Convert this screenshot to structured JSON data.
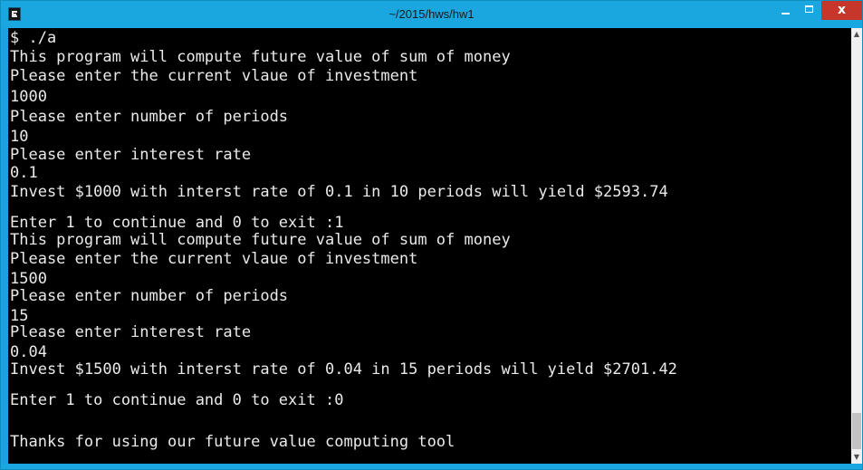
{
  "window": {
    "title": "~/2015/hws/hw1",
    "icon": "terminal-app-icon",
    "controls": {
      "minimize_icon": "minimize-icon",
      "maximize_icon": "maximize-icon",
      "close_label": "x"
    },
    "colors": {
      "titlebar": "#1aa6df",
      "close_button": "#c7362b",
      "console_bg": "#000000",
      "console_text": "#eaeaea"
    }
  },
  "console": {
    "lines": [
      "$ ./a",
      "This program will compute future value of sum of money",
      "Please enter the current vlaue of investment",
      "1000",
      "Please enter number of periods",
      "10",
      "Please enter interest rate",
      "0.1",
      "Invest $1000 with interst rate of 0.1 in 10 periods will yield $2593.74",
      "Enter 1 to continue and 0 to exit :1",
      "This program will compute future value of sum of money",
      "Please enter the current vlaue of investment",
      "1500",
      "Please enter number of periods",
      "15",
      "Please enter interest rate",
      "0.04",
      "Invest $1500 with interst rate of 0.04 in 15 periods will yield $2701.42",
      "Enter 1 to continue and 0 to exit :0",
      "Thanks for using our future value computing tool"
    ]
  },
  "scrollbar": {
    "up_icon": "scroll-up-arrow-icon",
    "down_icon": "scroll-down-arrow-icon",
    "up_glyph": "▲",
    "down_glyph": "▼"
  }
}
